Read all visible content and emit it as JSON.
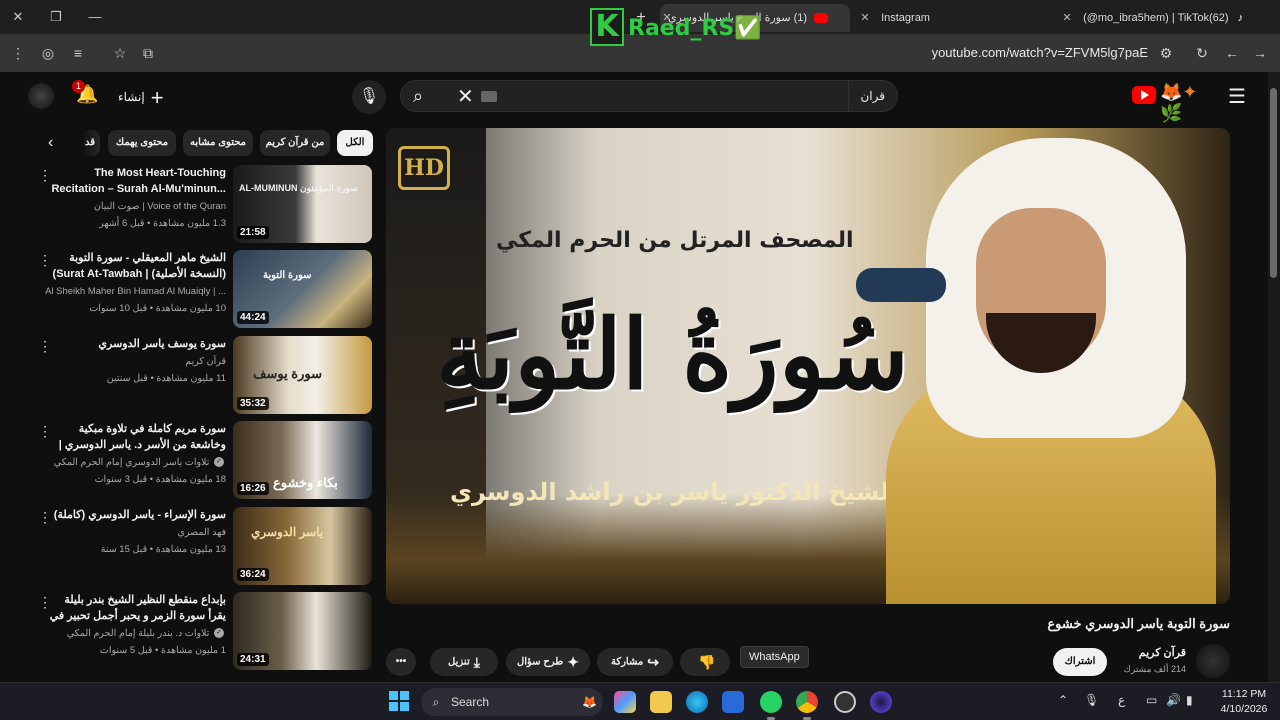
{
  "browser": {
    "window_controls": {
      "close": "✕",
      "restore": "❐",
      "minimize": "—"
    },
    "tabs": [
      {
        "title": "(1) سورة التوبة ياسر الدوسري",
        "active": true
      },
      {
        "title": "Instagram",
        "active": false
      },
      {
        "title": "(@mo_ibra5hem) | TikTok(62)",
        "active": false
      }
    ],
    "new_tab": "+",
    "url": "youtube.com/watch?v=ZFVM5lg7paE"
  },
  "watermark": {
    "logo_letter": "K",
    "text": "Raed_RS✅"
  },
  "header": {
    "search_query": "قران",
    "create_label": "إنشاء",
    "notification_count": "1"
  },
  "chips": [
    "الكل",
    "من قرآن كريم",
    "محتوى مشابه",
    "محتوى يهمك",
    "قد"
  ],
  "recommendations": [
    {
      "title": "The Most Heart-Touching Recitation – Surah Al-Mu'minun...",
      "channel": "Voice of the Quran | صوت البيان",
      "meta": "1.3 مليون مشاهدة • قبل 6 أشهر",
      "duration": "21:58",
      "thumb_text": "سورة المؤمنون AL-MUMINUN",
      "verified": false
    },
    {
      "title": "الشيخ ماهر المعيقلي - سورة التوبة (النسخة الأصلية) | Surat At-Tawbah) ...",
      "channel": "Al Sheikh Maher Bin Hamad Al Muaiqly | ...",
      "meta": "10 مليون مشاهدة • قبل 10 سنوات",
      "duration": "44:24",
      "thumb_text": "سورة التوبة",
      "verified": false
    },
    {
      "title": "سورة يوسف ياسر الدوسري",
      "channel": "قرآن كريم",
      "meta": "11 مليون مشاهدة • قبل سنتين",
      "duration": "35:32",
      "thumb_text": "سورة يوسف",
      "verified": false
    },
    {
      "title": "سورة مريم كاملة في تلاوة مبكية وخاشعة من الأسر د. ياسر الدوسري | ليالي رمضان ...",
      "channel": "تلاوات ياسر الدوسري إمام الحرم المكي",
      "meta": "18 مليون مشاهدة • قبل 3 سنوات",
      "duration": "16:26",
      "thumb_text": "بكاء وخشوع",
      "verified": true
    },
    {
      "title": "سورة الإسراء - ياسر الدوسري (كاملة)",
      "channel": "فهد المصري",
      "meta": "13 مليون مشاهدة • قبل 15 سنة",
      "duration": "36:24",
      "thumb_text": "ياسر الدوسري",
      "verified": false
    },
    {
      "title": "بإبداع منقطع النظير الشيخ بندر بليلة يقرأ سورة الزمر و يحبر أجمل تحبير في آخر ليلة...",
      "channel": "تلاوات د. بندر بليلة إمام الحرم المكي",
      "meta": "1 مليون مشاهدة • قبل 5 سنوات",
      "duration": "24:31",
      "thumb_text": "",
      "verified": true
    }
  ],
  "player": {
    "hd_badge": "HD",
    "top_line": "المصحف المرتل من الحرم المكي",
    "big_title": "سُورَةُ التَّوبَةِ",
    "sheikh_line": "للشيخ الدكتور ياسر بن راشد الدوسري"
  },
  "video": {
    "title": "سورة التوبة ياسر الدوسري خشوع",
    "channel": "قرآن كريم",
    "subscribers": "214 ألف مشترك",
    "subscribe_label": "اشتراك",
    "actions": {
      "download": "تنزيل",
      "ask": "طرح سؤال",
      "share": "مشاركة",
      "more": "•••"
    }
  },
  "tooltip": "WhatsApp",
  "taskbar": {
    "search_label": "Search",
    "tray_lang": "ع",
    "time": "11:12 PM",
    "date": "4/10/2026"
  },
  "colors": {
    "youtube_red": "#ff0000",
    "chip_selected": "#f1f1f1",
    "watermark_green": "#2ecc40",
    "windows_blue": "#4cc2ff"
  }
}
